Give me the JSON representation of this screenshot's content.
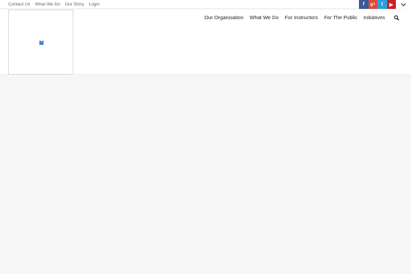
{
  "topbar": {
    "links": [
      {
        "label": "Contact Us"
      },
      {
        "label": "What We Do"
      },
      {
        "label": "Our Story"
      },
      {
        "label": "Login"
      }
    ]
  },
  "social": [
    {
      "icon": "facebook-icon",
      "glyph": "f",
      "color": "#3b5998"
    },
    {
      "icon": "google-plus-icon",
      "glyph": "g+",
      "color": "#dd4b39"
    },
    {
      "icon": "twitter-icon",
      "glyph": "t",
      "color": "#2aa0dc"
    },
    {
      "icon": "youtube-icon",
      "glyph": "▶",
      "color": "#cc2027"
    }
  ],
  "logo": {
    "broken_image_glyph": "?"
  },
  "nav": {
    "items": [
      {
        "label": "Our Organisation"
      },
      {
        "label": "What We Do"
      },
      {
        "label": "For Instructors"
      },
      {
        "label": "For The Public"
      },
      {
        "label": "Initiatives"
      }
    ]
  },
  "colors": {
    "page_background": "#f6f6f6",
    "header_background": "#ffffff",
    "nav_text": "#222222",
    "toplink_text": "#666666"
  }
}
